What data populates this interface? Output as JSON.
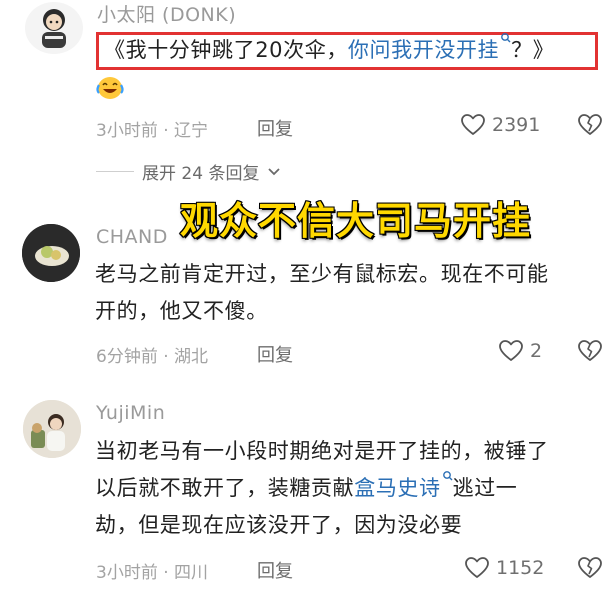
{
  "comments": [
    {
      "username": "小太阳 (DONK)",
      "text_plain": "《我十分钟跳了20次伞，",
      "text_link": "你问我开没开挂",
      "text_tail": "？》",
      "meta": "3小时前 · 辽宁",
      "reply_label": "回复",
      "likes": "2391"
    },
    {
      "username": "CHAND",
      "line1": "老马之前肯定开过，至少有鼠标宏。现在不可能",
      "line2": "开的，他又不傻。",
      "meta": "6分钟前 · 湖北",
      "reply_label": "回复",
      "likes": "2"
    },
    {
      "username": "YujiMin",
      "line1": "当初老马有一小段时期绝对是开了挂的，被锤了",
      "line2_plain": "以后就不敢开了，装糖贡献",
      "line2_link": "盒马史诗",
      "line2_tail": "逃过一",
      "line3": "劫，但是现在应该没开了，因为没必要",
      "meta": "3小时前 · 四川",
      "reply_label": "回复",
      "likes": "1152"
    }
  ],
  "expand_replies": "展开 24 条回复",
  "caption": "观众不信大司马开挂",
  "colors": {
    "link": "#2b6fb5",
    "highlight_border": "#e23232",
    "caption_fill": "#ffd800"
  },
  "icons": [
    "laughing-cry-emoji-icon",
    "search-mini-icon",
    "heart-outline-icon",
    "broken-heart-icon",
    "chevron-down-icon"
  ]
}
